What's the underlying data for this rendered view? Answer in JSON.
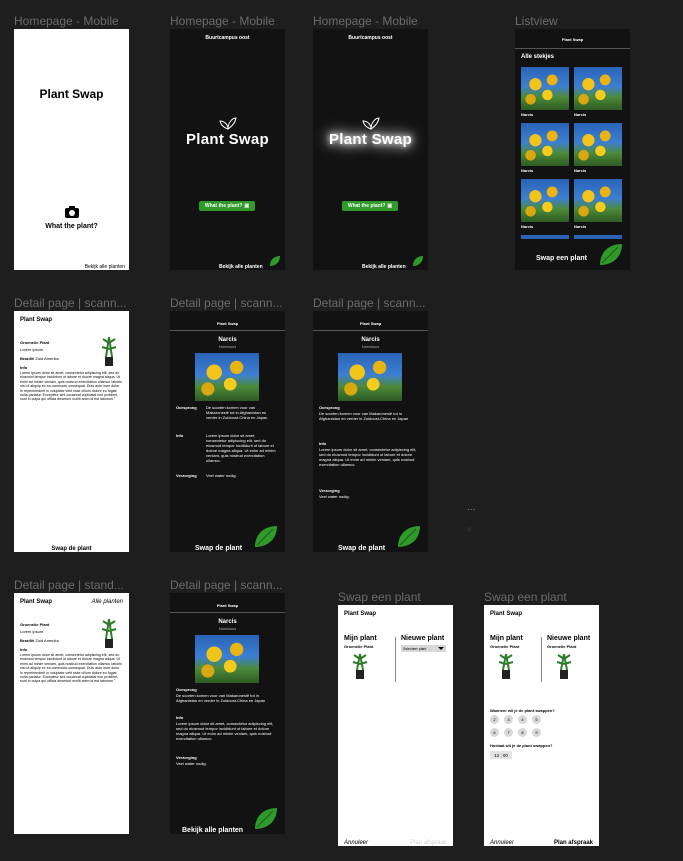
{
  "frames": {
    "home1": {
      "label": "Homepage  - Mobile",
      "title": "Plant Swap",
      "cta": "What the plant?",
      "footer": "Bekijk alle planten"
    },
    "home2": {
      "label": "Homepage  - Mobile",
      "header": "Buurtcampus oost",
      "title": "Plant Swap",
      "cta": "What the plant?",
      "footer": "Bekijk alle planten"
    },
    "home3": {
      "label": "Homepage  - Mobile",
      "header": "Buurtcampus oost",
      "title": "Plant Swap",
      "cta": "What the plant?",
      "footer": "Bekijk alle planten"
    },
    "listview": {
      "label": "Listview",
      "header": "Plant Swap",
      "section": "Alle stekjes",
      "item_name": "Narcis",
      "footer": "Swap een plant"
    },
    "detail1": {
      "label": "Detail page | scann...",
      "header": "Plant Swap",
      "plant_name": "Groenelie Plant",
      "latin": "Lorem ipsum",
      "origin_label": "Brazilië",
      "origin_value": "Zuid Amerika",
      "info_label": "Info",
      "info_text": "Lorem ipsum dolor sit amet, consectetur adipiscing elit, sed do eiusmod tempor incididunt ut labore et dolore magna aliqua. Ut enim ad minim veniam, quis nostrud exercitation ullamco laboris nisi ut aliquip ex ea commodo consequat. Duis aute irure dolor in reprehenderit in voluptate velit esse cillum dolore eu fugiat nulla pariatur. Excepteur sint occaecat cupidatat non proident, sunt in culpa qui officia deserunt mollit anim id est laborum.\"",
      "footer": "Swap de plant"
    },
    "detail2": {
      "label": "Detail page | scann...",
      "header": "Plant Swap",
      "plant_name": "Narcis",
      "latin": "Narcissus",
      "origin_label": "Oorsprong",
      "origin_text": "De soorten komen voor van Makaronesië tot in Afghanistan en verder in Zuidoost-China en Japan",
      "info_label": "Info",
      "info_text": "Lorem ipsum dolor sit amet, consectetur adipiscing elit, sed do eiusmod tempor incididunt ut labore et dolore magna aliqua. Ut enim ad minim veniam, quis nostrud exercitation ullamco.",
      "care_label": "Verzorging",
      "care_text": "Veel water nodig.",
      "footer": "Swap de plant"
    },
    "detail3": {
      "label": "Detail page | scann...",
      "header": "Plant Swap",
      "plant_name": "Narcis",
      "latin": "Narcissus",
      "origin_label": "Oorsprong",
      "origin_text": "De soorten komen voor van Makaronesië tot in Afghanistan en verder in Zuidoost-China en Japan",
      "info_label": "Info",
      "info_text": "Lorem ipsum dolor sit amet, consectetur adipiscing elit, sed do eiusmod tempor incididunt ut labore et dolore magna aliqua. Ut enim ad minim veniam, quis nostrud exercitation ullamco.",
      "care_label": "Verzorging",
      "care_text": "Veel water nodig.",
      "footer": "Swap de plant",
      "dots": "..."
    },
    "detail4": {
      "label": "Detail page | stand...",
      "header": "Plant Swap",
      "all_plants": "Alle planten",
      "plant_name": "Groenelie Plant",
      "latin": "Lorem ipsum",
      "origin_label": "Brazilië",
      "origin_value": "Zuid Amerika",
      "info_label": "Info",
      "info_text": "Lorem ipsum dolor sit amet, consectetur adipiscing elit, sed do eiusmod tempor incididunt ut labore et dolore magna aliqua. Ut enim ad minim veniam, quis nostrud exercitation ullamco laboris nisi ut aliquip ex ea commodo consequat. Duis aute irure dolor in reprehenderit in voluptate velit esse cillum dolore eu fugiat nulla pariatur. Excepteur sint occaecat cupidatat non proident, sunt in culpa qui officia deserunt mollit anim id est laborum.\""
    },
    "detail5": {
      "label": "Detail page | scann...",
      "header": "Plant Swap",
      "plant_name": "Narcis",
      "latin": "Narcissus",
      "origin_label": "Oorsprong",
      "origin_text": "De soorten komen voor van Makaronesië tot in Afghanistan en verder in Zuidoost-China en Japan",
      "info_label": "Info",
      "info_text": "Lorem ipsum dolor sit amet, consectetur adipiscing elit, sed do eiusmod tempor incididunt ut labore et dolore magna aliqua. Ut enim ad minim veniam, quis nostrud exercitation ullamco.",
      "care_label": "Verzorging",
      "care_text": "Veel water nodig.",
      "footer": "Bekijk alle planten"
    },
    "swap1": {
      "label": "Swap een plant",
      "header": "Plant Swap",
      "mine": "Mijn plant",
      "mine_name": "Groenelie Plant",
      "new": "Nieuwe plant",
      "select": "Selecteer plant",
      "cancel": "Annuleer",
      "confirm": "Plan afspraak"
    },
    "swap2": {
      "label": "Swap een plant",
      "header": "Plant Swap",
      "mine": "Mijn plant",
      "mine_name": "Groenelie Plant",
      "new": "Nieuwe plant",
      "new_name": "Groenelie Plant",
      "when_q": "Wanneer wil je de plant swappen?",
      "days": [
        "2",
        "3",
        "4",
        "5",
        "6",
        "7",
        "8",
        "9"
      ],
      "time_q": "Hoelaat wil je de plant swappen?",
      "time": "12 : 00",
      "cancel": "Annuleer",
      "confirm": "Plan afspraak"
    }
  },
  "colors": {
    "green": "#2f9a2a",
    "dark_bg": "#121212",
    "canvas": "#1e1e1e",
    "label": "#6b6b6b"
  }
}
